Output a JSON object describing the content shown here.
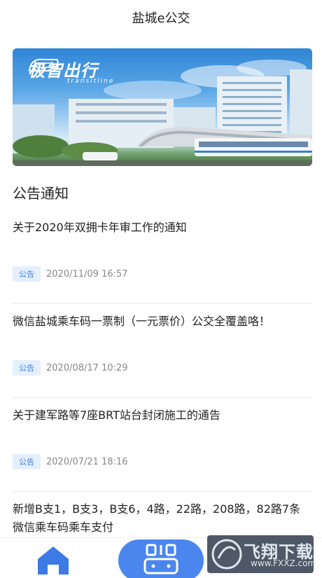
{
  "header": {
    "title": "盐城e公交"
  },
  "banner": {
    "logo_text": "极智出行",
    "logo_sub": "transitline"
  },
  "section": {
    "title": "公告通知"
  },
  "notices": [
    {
      "title": "关于2020年双拥卡年审工作的通知",
      "tag": "公告",
      "date": "2020/11/09 16:57"
    },
    {
      "title": "微信盐城乘车码一票制（一元票价）公交全覆盖咯！",
      "tag": "公告",
      "date": "2020/08/17 10:29"
    },
    {
      "title": "关于建军路等7座BRT站台封闭施工的通告",
      "tag": "公告",
      "date": "2020/07/21 18:16"
    },
    {
      "title": "新增B支1，B支3，B支6，4路，22路，208路，82路7条微信乘车码乘车支付"
    }
  ],
  "tabbar": {
    "home_icon": "home-icon",
    "scan_icon": "bus-code-icon"
  },
  "watermark": {
    "text": "飞翔下载",
    "url": "www.FXXZ.com"
  },
  "colors": {
    "accent": "#4a86ee",
    "tag_bg": "#e4efff",
    "tag_text": "#3d7ee8"
  }
}
